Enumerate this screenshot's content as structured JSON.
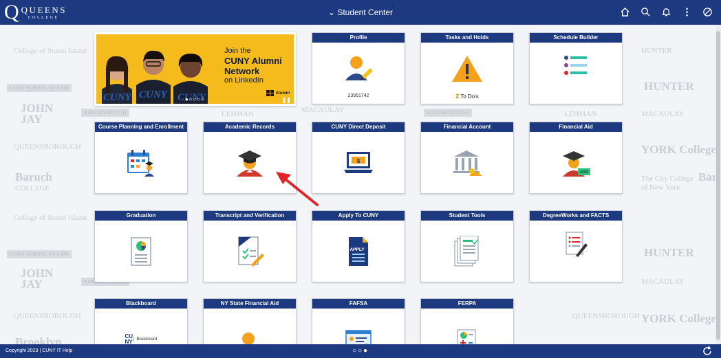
{
  "header": {
    "logo_letter": "Q",
    "logo_name": "QUEENS",
    "logo_sub": "COLLEGE",
    "title": "⌄ Student Center",
    "icons": [
      "home-icon",
      "search-icon",
      "bell-icon",
      "more-icon",
      "nav-compass-icon"
    ]
  },
  "banner": {
    "line1": "Join the",
    "line2": "CUNY Alumni",
    "line3": "Network",
    "line4": "on LinkedIn",
    "alumni_label": "Alumni",
    "dots": "●○○○○",
    "pause": "❚❚",
    "shirt_text": "CUNY"
  },
  "tiles": [
    {
      "id": "profile",
      "title": "Profile",
      "number": "23951742"
    },
    {
      "id": "tasks-holds",
      "title": "Tasks and Holds",
      "todo_count": "2",
      "todo_label": "To Do's"
    },
    {
      "id": "schedule-builder",
      "title": "Schedule Builder"
    },
    {
      "id": "course-planning",
      "title": "Course Planning and Enrollment"
    },
    {
      "id": "academic-records",
      "title": "Academic Records"
    },
    {
      "id": "direct-deposit",
      "title": "CUNY Direct Deposit"
    },
    {
      "id": "financial-account",
      "title": "Financial Account"
    },
    {
      "id": "financial-aid",
      "title": "Financial Aid"
    },
    {
      "id": "graduation",
      "title": "Graduation"
    },
    {
      "id": "transcript",
      "title": "Transcript and Verification"
    },
    {
      "id": "apply-cuny",
      "title": "Apply To CUNY",
      "doc_label": "APPLY"
    },
    {
      "id": "student-tools",
      "title": "Student Tools"
    },
    {
      "id": "degreeworks",
      "title": "DegreeWorks and FACTS"
    },
    {
      "id": "blackboard",
      "title": "Blackboard",
      "brand": "Blackboard",
      "brand_mark": "CU NY"
    },
    {
      "id": "ny-state-aid",
      "title": "NY State Financial Aid"
    },
    {
      "id": "fafsa",
      "title": "FAFSA"
    },
    {
      "id": "ferpa",
      "title": "FERPA"
    }
  ],
  "background_logos": {
    "college_si": "College of Staten Island",
    "john": "JOHN",
    "jay": "JAY",
    "kingsborough": "KINGSBOROUGH",
    "lehman": "LEHMAN",
    "macaulay": "MACAULAY",
    "hunter": "HUNTER",
    "york": "YORK College",
    "baruch": "Baruch",
    "college_word": "COLLEGE",
    "ccny1": "The City College",
    "ccny2": "of New York",
    "queensborough": "QUEENSBOROUGH",
    "grad_school": "CUNY SCHOOL OF LAW",
    "brooklyn": "Brooklyn"
  },
  "footer": {
    "copyright": "Copyright 2023 | CUNY IT Help",
    "dots": "○○●"
  },
  "colors": {
    "brand": "#1d3a80",
    "banner_yellow": "#f5ba1b",
    "accent_orange": "#f4a11b",
    "icon_blue": "#2b4a8b",
    "annotation_red": "#e0262b"
  }
}
